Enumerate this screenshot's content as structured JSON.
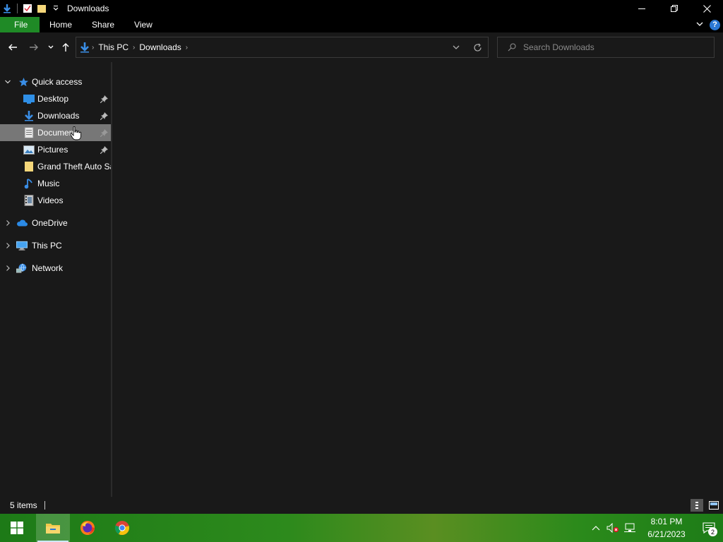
{
  "window": {
    "title": "Downloads"
  },
  "ribbon": {
    "tabs": [
      {
        "label": "File"
      },
      {
        "label": "Home"
      },
      {
        "label": "Share"
      },
      {
        "label": "View"
      }
    ],
    "help_label": "?"
  },
  "address": {
    "crumbs": [
      "This PC",
      "Downloads"
    ]
  },
  "search": {
    "placeholder": "Search Downloads"
  },
  "sidebar": {
    "quick_access": "Quick access",
    "items": [
      {
        "label": "Desktop",
        "icon": "desktop-icon",
        "pinned": true
      },
      {
        "label": "Downloads",
        "icon": "download-arrow-icon",
        "pinned": true
      },
      {
        "label": "Documents",
        "icon": "document-icon",
        "pinned": true
      },
      {
        "label": "Pictures",
        "icon": "pictures-icon",
        "pinned": true
      },
      {
        "label": "Grand Theft Auto Sa",
        "icon": "folder-icon",
        "pinned": false
      },
      {
        "label": "Music",
        "icon": "music-note-icon",
        "pinned": false
      },
      {
        "label": "Videos",
        "icon": "video-icon",
        "pinned": false
      }
    ],
    "onedrive": "OneDrive",
    "this_pc": "This PC",
    "network": "Network"
  },
  "status": {
    "item_count": "5 items"
  },
  "taskbar": {
    "time": "8:01 PM",
    "date": "6/21/2023",
    "notification_count": "2"
  },
  "colors": {
    "file_tab": "#1f8a26",
    "selected_item": "#777777",
    "accent_blue": "#2b78d4",
    "panel_bg": "#191919"
  }
}
